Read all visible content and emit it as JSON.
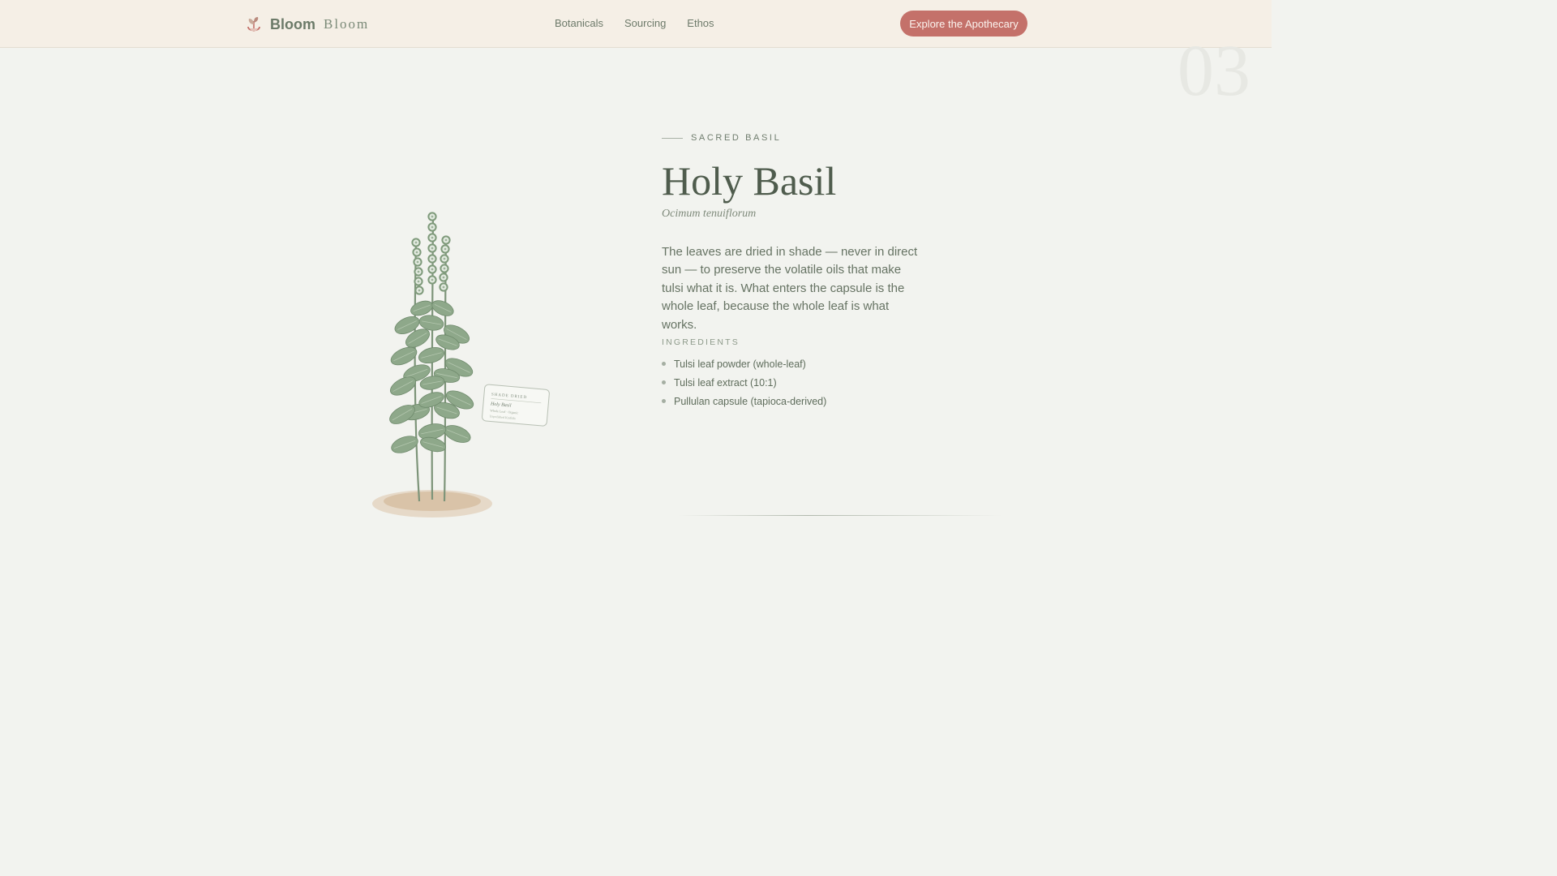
{
  "nav": {
    "brand_name": "Bloom",
    "brand_sub": "Bloom",
    "brand_icon": "sprout-icon",
    "links": [
      "Botanicals",
      "Sourcing",
      "Ethos"
    ],
    "cta": "Explore the Apothecary"
  },
  "colors": {
    "accent": "#c4716a",
    "background": "#f2f3ef",
    "header": "#f5efe6",
    "heading": "#4f5c4d",
    "leaf": "#8ea88a"
  },
  "slide": {
    "number": "03",
    "eyebrow": "SACRED BASIL",
    "title": "Holy Basil",
    "latin": "Ocimum tenuiflorum",
    "description": "The leaves are dried in shade — never in direct sun — to preserve the volatile oils that make tulsi what it is. What enters the capsule is the whole leaf, because the whole leaf is what works.",
    "ingredients_heading": "INGREDIENTS",
    "ingredients": [
      "Tulsi leaf powder (whole-leaf)",
      "Tulsi leaf extract (10:1)",
      "Pullulan capsule (tapioca-derived)"
    ]
  },
  "illustration": {
    "tag_title": "SHADE DRIED",
    "tag_name": "Holy Basil",
    "tag_line1": "Whole Leaf · Organic",
    "tag_line2": "Unpolished Kraftiln"
  }
}
